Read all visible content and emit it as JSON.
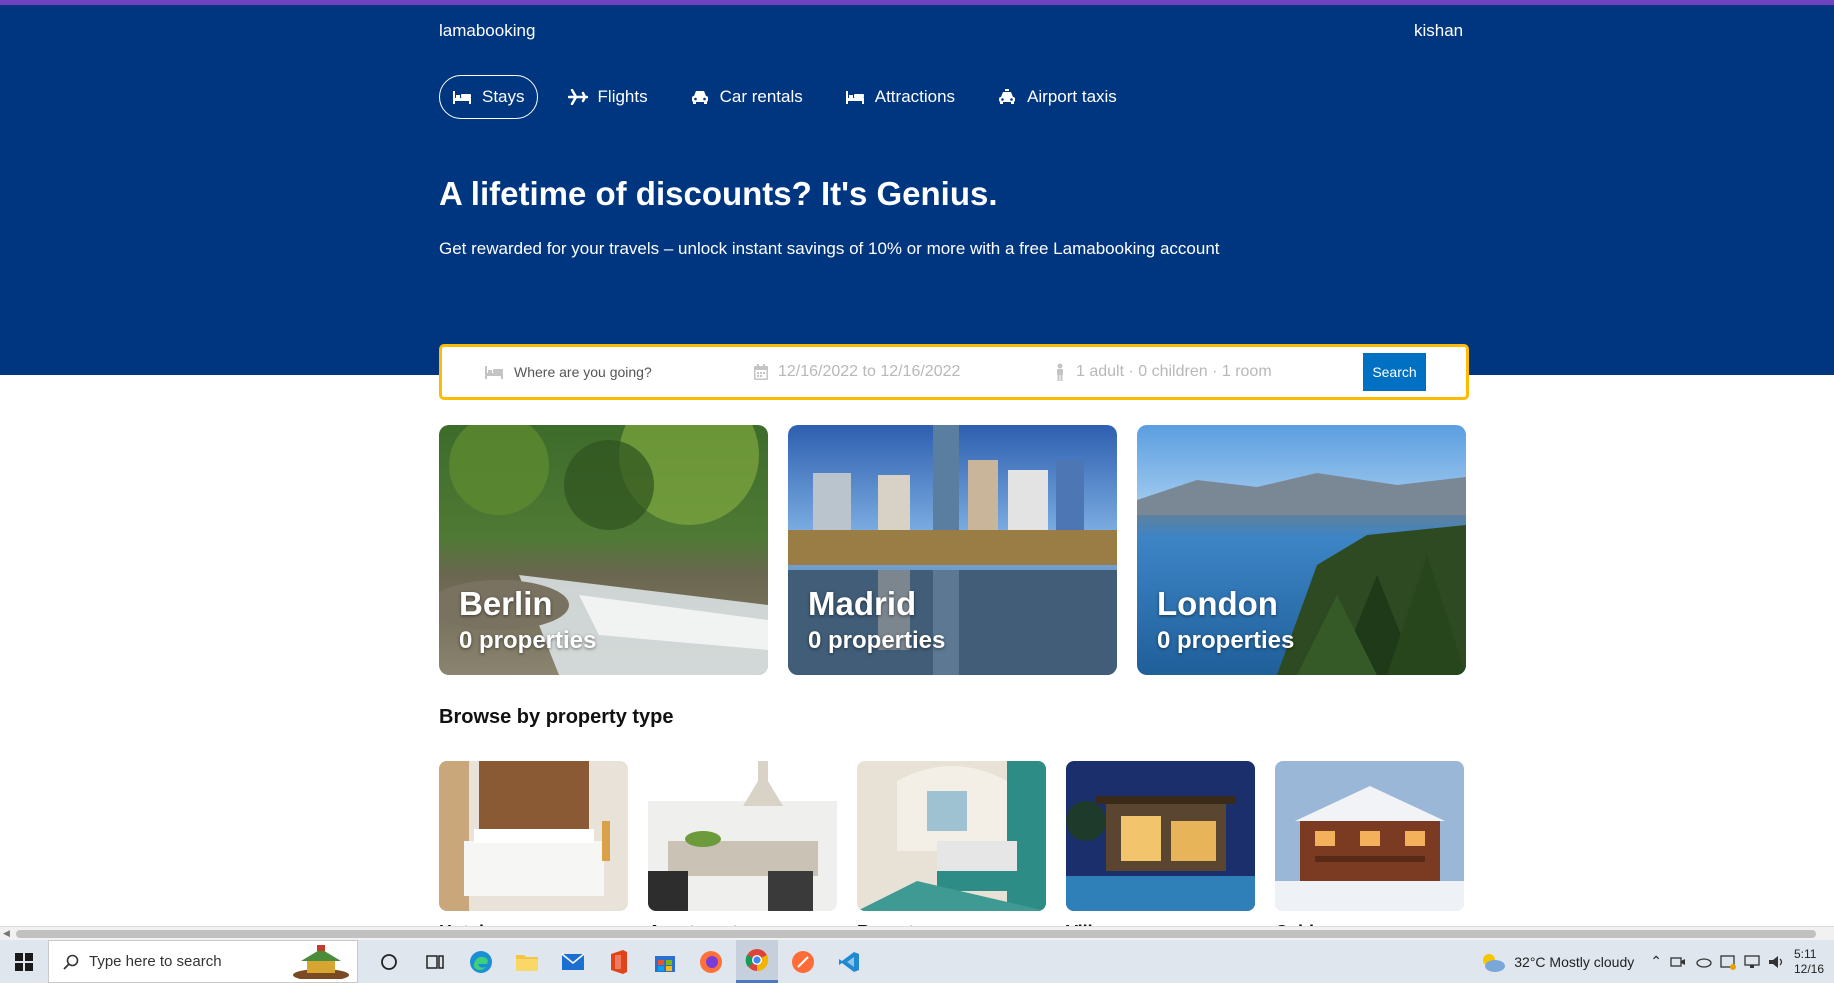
{
  "header": {
    "brand": "lamabooking",
    "user": "kishan",
    "nav": [
      {
        "label": "Stays",
        "icon": "bed-icon",
        "active": true
      },
      {
        "label": "Flights",
        "icon": "plane-icon",
        "active": false
      },
      {
        "label": "Car rentals",
        "icon": "car-icon",
        "active": false
      },
      {
        "label": "Attractions",
        "icon": "bed-icon",
        "active": false
      },
      {
        "label": "Airport taxis",
        "icon": "taxi-icon",
        "active": false
      }
    ],
    "title": "A lifetime of discounts? It's Genius.",
    "subtitle": "Get rewarded for your travels – unlock instant savings of 10% or more with a free Lamabooking account"
  },
  "search": {
    "destination_placeholder": "Where are you going?",
    "dates": "12/16/2022 to 12/16/2022",
    "options": "1 adult · 0 children · 1 room",
    "button": "Search"
  },
  "featured": [
    {
      "city": "Berlin",
      "count": "0 properties"
    },
    {
      "city": "Madrid",
      "count": "0 properties"
    },
    {
      "city": "London",
      "count": "0 properties"
    }
  ],
  "property_types": {
    "title": "Browse by property type",
    "items": [
      {
        "label": "Hotels"
      },
      {
        "label": "Apartments"
      },
      {
        "label": "Resorts"
      },
      {
        "label": "Villas"
      },
      {
        "label": "Cabins"
      }
    ]
  },
  "taskbar": {
    "search_placeholder": "Type here to search",
    "weather": "32°C  Mostly cloudy",
    "time": "5:11",
    "date": "12/16"
  },
  "colors": {
    "header_bg": "#003580",
    "search_border": "#febb02",
    "search_button": "#0071c2",
    "accent_bar": "#6f42c1"
  }
}
